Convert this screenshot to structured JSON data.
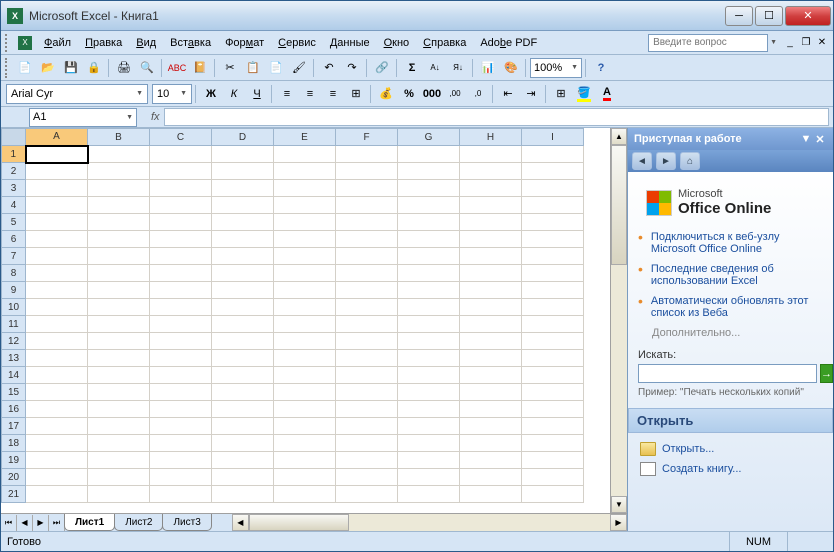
{
  "titlebar": {
    "title": "Microsoft Excel - Книга1"
  },
  "menubar": {
    "items": [
      "Файл",
      "Правка",
      "Вид",
      "Вставка",
      "Формат",
      "Сервис",
      "Данные",
      "Окно",
      "Справка",
      "Adobe PDF"
    ],
    "underlines": [
      "Ф",
      "П",
      "В",
      "В",
      "Ф",
      "С",
      "Д",
      "О",
      "С",
      "A"
    ],
    "search_placeholder": "Введите вопрос"
  },
  "toolbar": {
    "zoom": "100%"
  },
  "format": {
    "font_name": "Arial Cyr",
    "font_size": "10"
  },
  "namebox": {
    "cell_ref": "A1",
    "fx": "fx"
  },
  "grid": {
    "columns": [
      "A",
      "B",
      "C",
      "D",
      "E",
      "F",
      "G",
      "H",
      "I"
    ],
    "rows": [
      "1",
      "2",
      "3",
      "4",
      "5",
      "6",
      "7",
      "8",
      "9",
      "10",
      "11",
      "12",
      "13",
      "14",
      "15",
      "16",
      "17",
      "18",
      "19",
      "20",
      "21"
    ],
    "selected_cell": "A1"
  },
  "sheets": {
    "tabs": [
      "Лист1",
      "Лист2",
      "Лист3"
    ],
    "active": 0
  },
  "taskpane": {
    "title": "Приступая к работе",
    "office_online": "Office Online",
    "office_prefix": "Microsoft",
    "links": [
      "Подключиться к веб-узлу Microsoft Office Online",
      "Последние сведения об использовании Excel",
      "Автоматически обновлять этот список из Веба"
    ],
    "more": "Дополнительно...",
    "search_label": "Искать:",
    "example_prefix": "Пример:",
    "example_text": "\"Печать нескольких копий\"",
    "open_section": "Открыть",
    "open_link": "Открыть...",
    "create_link": "Создать книгу..."
  },
  "statusbar": {
    "ready": "Готово",
    "num": "NUM"
  }
}
